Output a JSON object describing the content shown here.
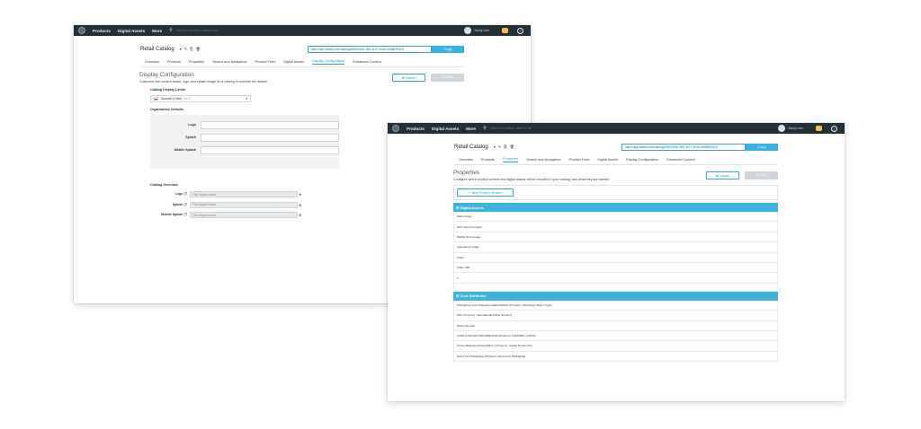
{
  "topbar": {
    "nav": [
      "Products",
      "Digital Assets",
      "More"
    ],
    "search_placeholder": "Jump to a product, asset or list",
    "user_name": "Sandy User",
    "help": "?"
  },
  "catalog": {
    "title": "Retail Catalog",
    "tools": "▾ ✎ ⎘ 🗑",
    "url": "https://app.salsify.com/catalogs/8002b4f4c-f6f3-4e27-9e4b-c46b8f2f04c5",
    "copy_label": "Copy"
  },
  "tabs": [
    "Overview",
    "Products",
    "Properties",
    "Search and Navigation",
    "Product Feed",
    "Digital Assets",
    "Display Configuration",
    "Enhanced Content"
  ],
  "buttons": {
    "cancel": "✖ Cancel",
    "save": "🖫 Save"
  },
  "display_config": {
    "title": "Display Configuration",
    "description": "Customize the content locale, logo, and splash image for a catalog to override the default.",
    "locale_label": "Catalog Display Locale",
    "locale_value": "Spanish (Chile)",
    "locale_code": "es-CL",
    "org_defaults_label": "Organization Defaults",
    "org_fields": [
      "Logo",
      "Splash",
      "Mobile Splash"
    ],
    "overrides_label": "Catalog Overrides",
    "override_fields": [
      {
        "label": "Logo ⓘ",
        "placeholder": "Find Digital Assets"
      },
      {
        "label": "Splash ⓘ",
        "placeholder": "Find Digital Assets"
      },
      {
        "label": "Mobile Splash ⓘ",
        "placeholder": "Find Digital Assets"
      }
    ]
  },
  "properties": {
    "title": "Properties",
    "description": "Configure which product content and digital assets will be included in your catalog, and what they are named.",
    "add_section": "+ New Property Section",
    "groups": [
      {
        "name": "⊟  Digital Assets",
        "rows": [
          "Main Image",
          "GPC Sorted Images",
          "Mobile Hero Image",
          "Ingredients Image",
          "Video",
          "Video URL",
          "ri"
        ]
      },
      {
        "name": "⊟  Core Attributes",
        "rows": [
          "Packaging Level (Case/Inner/Each/Pallet) (Property: Packaging Object Type)",
          "UPC (Property: International Article Number)",
          "Model Number",
          "CASE & PALLET INFORMATION (Property: FINISHED_GOOD)",
          "Clorox Material Number/FEIT 4 (Property: Salsify Product ID)",
          "Next Level Packaging (Property: Next Level Packaging)"
        ]
      }
    ]
  }
}
